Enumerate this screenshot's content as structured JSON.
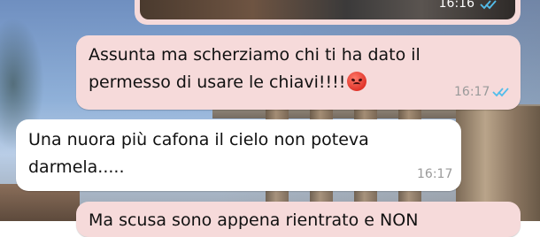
{
  "messages": [
    {
      "id": "img",
      "type": "image",
      "time": "16:16",
      "direction": "outgoing",
      "status": "read"
    },
    {
      "id": "m2",
      "type": "text",
      "direction": "outgoing",
      "line1": "Assunta ma scherziamo chi ti ha dato il",
      "line2": "permesso di usare le chiavi!!!!",
      "emoji": "angry-face",
      "time": "16:17",
      "status": "read"
    },
    {
      "id": "m3",
      "type": "text",
      "direction": "incoming",
      "line1": "Una nuora più cafona il cielo non poteva",
      "line2": "darmela.....",
      "time": "16:17"
    },
    {
      "id": "m4",
      "type": "text",
      "direction": "outgoing",
      "line1": "Ma scusa sono appena rientrato e NON"
    }
  ],
  "colors": {
    "outgoing_bubble": "#f6dada",
    "incoming_bubble": "#ffffff",
    "read_tick": "#53bdeb"
  }
}
